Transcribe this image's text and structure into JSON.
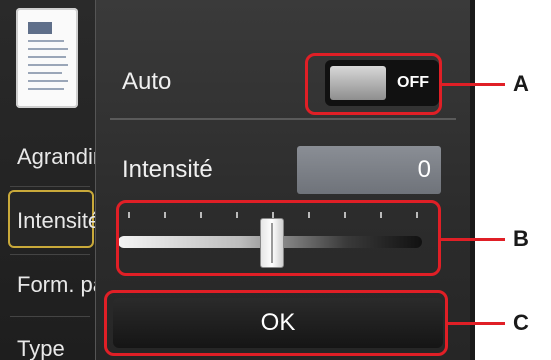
{
  "menu": {
    "items": [
      {
        "label": "Agrandir/Réduire",
        "selected": false
      },
      {
        "label": "Intensité",
        "selected": true
      },
      {
        "label": "Form. page",
        "selected": false
      },
      {
        "label": "Type",
        "selected": false
      }
    ]
  },
  "dialog": {
    "auto_label": "Auto",
    "auto_state": "OFF",
    "intensity_label": "Intensité",
    "intensity_value": "0",
    "slider_level": 0,
    "slider_range": [
      -4,
      4
    ],
    "ok_label": "OK"
  },
  "callouts": {
    "a": "A",
    "b": "B",
    "c": "C",
    "color": "#e01f26"
  }
}
